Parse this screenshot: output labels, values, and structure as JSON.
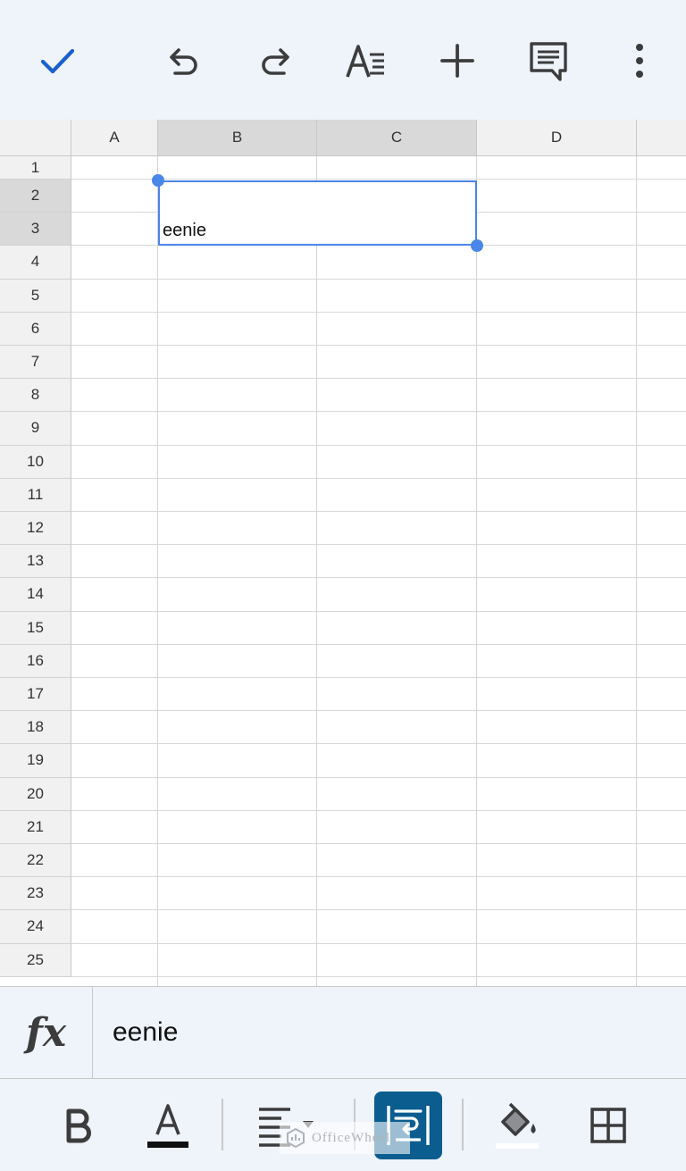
{
  "columns": [
    "A",
    "B",
    "C",
    "D"
  ],
  "selected_columns": [
    "B",
    "C"
  ],
  "rows": [
    "1",
    "2",
    "3",
    "4",
    "5",
    "6",
    "7",
    "8",
    "9",
    "10",
    "11",
    "12",
    "13",
    "14",
    "15",
    "16",
    "17",
    "18",
    "19",
    "20",
    "21",
    "22",
    "23",
    "24",
    "25"
  ],
  "selected_rows": [
    "2",
    "3"
  ],
  "cell": {
    "value": "eenie"
  },
  "formula_bar": {
    "fx_label": "fx",
    "value": "eenie"
  },
  "watermark": {
    "text": "OfficeWheel"
  },
  "colors": {
    "accent": "#4a86e8",
    "toolbar_bg": "#eff3fa",
    "wrap_active": "#0b5d8f"
  },
  "icons": {
    "toolbar": [
      "check-icon",
      "undo-icon",
      "redo-icon",
      "text-format-icon",
      "plus-icon",
      "comment-icon",
      "more-vert-icon"
    ],
    "bottom": [
      "bold-icon",
      "text-color-icon",
      "align-icon",
      "wrap-icon",
      "fill-color-icon",
      "borders-icon"
    ]
  }
}
